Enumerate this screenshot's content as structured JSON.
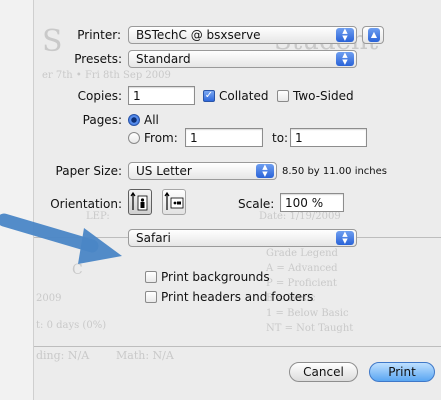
{
  "dialog": {
    "printer_label": "Printer:",
    "printer_value": "BSTechC @ bsxserve",
    "presets_label": "Presets:",
    "presets_value": "Standard",
    "copies_label": "Copies:",
    "copies_value": "1",
    "collated_label": "Collated",
    "two_sided_label": "Two-Sided",
    "pages_label": "Pages:",
    "all_label": "All",
    "from_label": "From:",
    "from_value": "1",
    "to_label": "to:",
    "to_value": "1",
    "paper_size_label": "Paper Size:",
    "paper_size_value": "US Letter",
    "paper_size_dims": "8.50 by 11.00 inches",
    "orientation_label": "Orientation:",
    "scale_label": "Scale:",
    "scale_value": "100 %",
    "app_menu_value": "Safari",
    "print_backgrounds_label": "Print backgrounds",
    "print_headers_footers_label": "Print headers and footers",
    "cancel_label": "Cancel",
    "print_label": "Print",
    "collated_checked": true,
    "two_sided_checked": false,
    "print_backgrounds_checked": false,
    "print_headers_footers_checked": false,
    "pages_mode": "all"
  },
  "background_ghost_text": {
    "word_s": "S",
    "title_fragment": "Student",
    "line_a": "er 7th  •  Fri 8th Sep 2009",
    "lep": "LEP:",
    "date_label": "Date: 1/19/2009",
    "legend_1": "Grade Legend",
    "legend_2": "A = Advanced",
    "legend_3": "P = Proficient",
    "legend_4": "B = Basic",
    "legend_5": "1 = Below Basic",
    "legend_6": "NT = Not Taught",
    "course": "C",
    "year": "2009",
    "days": "t: 0 days (0%)",
    "reading": "ding: N/A",
    "math": "Math: N/A"
  },
  "colors": {
    "accent_blue": "#3b78d6",
    "arrow_blue": "#4a86c6",
    "sheet": "#ececec"
  },
  "icons": {
    "printer_menu": "up-down-arrows-icon",
    "disclosure": "disclosure-triangle-icon",
    "portrait": "portrait-orientation-icon",
    "landscape": "landscape-orientation-icon",
    "annotation": "arrow-annotation-icon"
  }
}
